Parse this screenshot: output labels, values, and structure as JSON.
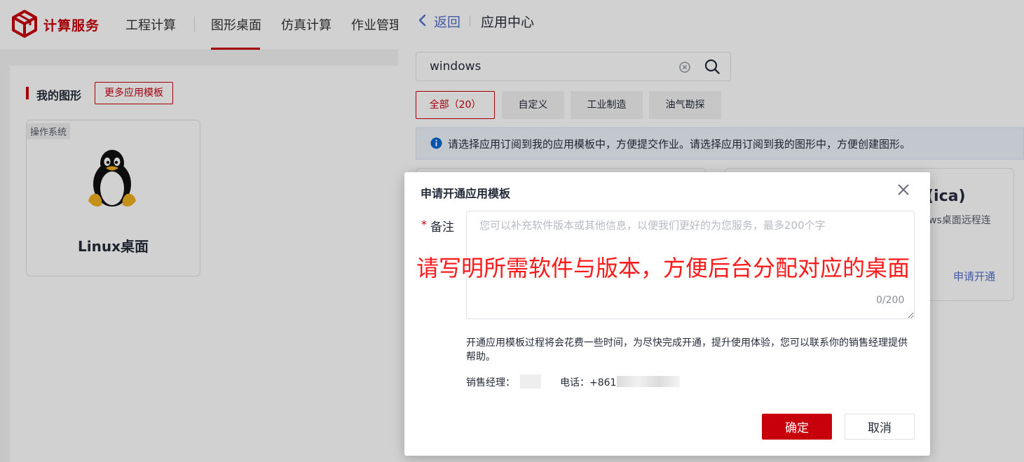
{
  "topbar": {
    "brand": "计算服务",
    "nav": [
      {
        "label": "工程计算",
        "active": false
      },
      {
        "label": "图形桌面",
        "active": true
      },
      {
        "label": "仿真计算",
        "active": false
      },
      {
        "label": "作业管理",
        "active": false
      }
    ]
  },
  "main": {
    "section_title": "我的图形",
    "more_button": "更多应用模板",
    "card": {
      "tag": "操作系统",
      "name": "Linux桌面",
      "icon": "linux-penguin-icon"
    }
  },
  "drawer": {
    "back": "返回",
    "title": "应用中心",
    "search": {
      "value": "windows"
    },
    "tags": [
      {
        "label": "全部（20）",
        "active": true
      },
      {
        "label": "自定义",
        "active": false
      },
      {
        "label": "工业制造",
        "active": false
      },
      {
        "label": "油气勘探",
        "active": false
      }
    ],
    "info": "请选择应用订阅到我的应用模板中，方便提交作业。请选择应用订阅到我的图形中，方便创建图形。",
    "app_card": {
      "title_fragment": "(ica)",
      "desc_fragment": "ws桌面远程连",
      "action": "申请开通"
    }
  },
  "modal": {
    "title": "申请开通应用模板",
    "required_mark": "*",
    "field_label": "备注",
    "placeholder": "您可以补充软件版本或其他信息，以便我们更好的为您服务，最多200个字",
    "char_count": "0/200",
    "annotation": "请写明所需软件与版本，方便后台分配对应的桌面",
    "notice": "开通应用模板过程将会花费一些时间，为尽快完成开通，提升使用体验，您可以联系你的销售经理提供帮助。",
    "manager_label": "销售经理：",
    "phone_label": "电话：+861",
    "confirm": "确定",
    "cancel": "取消"
  },
  "colors": {
    "brand": "#c7000b",
    "link": "#526ecc",
    "annotation": "#ff1a1a",
    "info_bg": "#eef4fc"
  }
}
